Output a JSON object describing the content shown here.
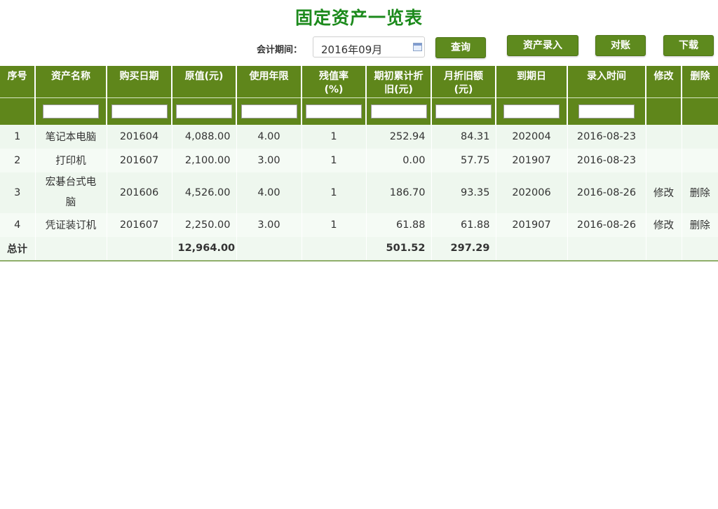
{
  "page": {
    "title": "固定资产一览表"
  },
  "toolbar": {
    "period_label": "会计期间：",
    "period_value": "2016年09月",
    "query_label": "查询",
    "entry_label": "资产录入",
    "reconcile_label": "对账",
    "download_label": "下载"
  },
  "table": {
    "headers": {
      "seq": "序号",
      "name": "资产名称",
      "purchase": "购买日期",
      "original": "原值(元)",
      "years": "使用年限",
      "residual_a": "残值率",
      "residual_b": "(%)",
      "accum_a": "期初累计折",
      "accum_b": "旧(元)",
      "monthly_a": "月折旧额",
      "monthly_b": "(元)",
      "expire": "到期日",
      "entered": "录入时间",
      "edit": "修改",
      "delete": "删除"
    },
    "rows": [
      {
        "seq": "1",
        "name": "笔记本电脑",
        "purchase": "201604",
        "original": "4,088.00",
        "years": "4.00",
        "residual": "1",
        "accum": "252.94",
        "monthly": "84.31",
        "expire": "202004",
        "entered": "2016-08-23",
        "edit": "",
        "delete": ""
      },
      {
        "seq": "2",
        "name": "打印机",
        "purchase": "201607",
        "original": "2,100.00",
        "years": "3.00",
        "residual": "1",
        "accum": "0.00",
        "monthly": "57.75",
        "expire": "201907",
        "entered": "2016-08-23",
        "edit": "",
        "delete": ""
      },
      {
        "seq": "3",
        "name_a": "宏碁台式电",
        "name_b": "脑",
        "purchase": "201606",
        "original": "4,526.00",
        "years": "4.00",
        "residual": "1",
        "accum": "186.70",
        "monthly": "93.35",
        "expire": "202006",
        "entered": "2016-08-26",
        "edit": "修改",
        "delete": "删除"
      },
      {
        "seq": "4",
        "name": "凭证装订机",
        "purchase": "201607",
        "original": "2,250.00",
        "years": "3.00",
        "residual": "1",
        "accum": "61.88",
        "monthly": "61.88",
        "expire": "201907",
        "entered": "2016-08-26",
        "edit": "修改",
        "delete": "删除"
      }
    ],
    "total": {
      "label": "总计",
      "original": "12,964.00",
      "accum": "501.52",
      "monthly": "297.29"
    }
  },
  "icons": {
    "calendar": "calendar-icon"
  },
  "colors": {
    "title": "#1c8a1c",
    "header_bg": "#5f861b",
    "button_bg": "#5e8a1e",
    "link": "#2fa84a"
  }
}
